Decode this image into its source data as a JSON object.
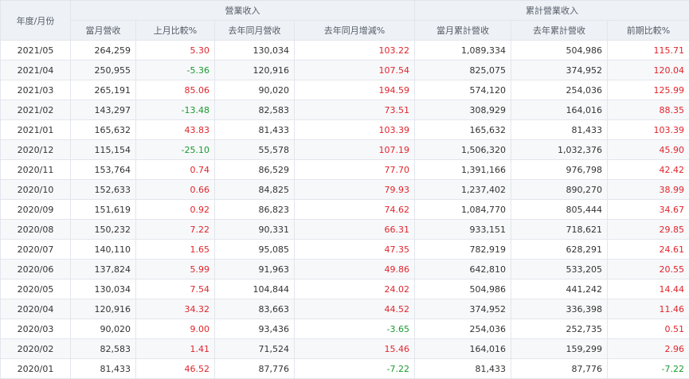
{
  "headers": {
    "month": "年度/月份",
    "group_revenue": "營業收入",
    "group_cumulative": "累計營業收入",
    "cols": [
      "當月營收",
      "上月比較%",
      "去年同月營收",
      "去年同月增減%",
      "當月累計營收",
      "去年累計營收",
      "前期比較%"
    ]
  },
  "colors": {
    "positive": "#e0242b",
    "negative": "#1a9a2f"
  },
  "rows": [
    [
      "2021/05",
      "264,259",
      "5.30",
      "130,034",
      "103.22",
      "1,089,334",
      "504,986",
      "115.71"
    ],
    [
      "2021/04",
      "250,955",
      "-5.36",
      "120,916",
      "107.54",
      "825,075",
      "374,952",
      "120.04"
    ],
    [
      "2021/03",
      "265,191",
      "85.06",
      "90,020",
      "194.59",
      "574,120",
      "254,036",
      "125.99"
    ],
    [
      "2021/02",
      "143,297",
      "-13.48",
      "82,583",
      "73.51",
      "308,929",
      "164,016",
      "88.35"
    ],
    [
      "2021/01",
      "165,632",
      "43.83",
      "81,433",
      "103.39",
      "165,632",
      "81,433",
      "103.39"
    ],
    [
      "2020/12",
      "115,154",
      "-25.10",
      "55,578",
      "107.19",
      "1,506,320",
      "1,032,376",
      "45.90"
    ],
    [
      "2020/11",
      "153,764",
      "0.74",
      "86,529",
      "77.70",
      "1,391,166",
      "976,798",
      "42.42"
    ],
    [
      "2020/10",
      "152,633",
      "0.66",
      "84,825",
      "79.93",
      "1,237,402",
      "890,270",
      "38.99"
    ],
    [
      "2020/09",
      "151,619",
      "0.92",
      "86,823",
      "74.62",
      "1,084,770",
      "805,444",
      "34.67"
    ],
    [
      "2020/08",
      "150,232",
      "7.22",
      "90,331",
      "66.31",
      "933,151",
      "718,621",
      "29.85"
    ],
    [
      "2020/07",
      "140,110",
      "1.65",
      "95,085",
      "47.35",
      "782,919",
      "628,291",
      "24.61"
    ],
    [
      "2020/06",
      "137,824",
      "5.99",
      "91,963",
      "49.86",
      "642,810",
      "533,205",
      "20.55"
    ],
    [
      "2020/05",
      "130,034",
      "7.54",
      "104,844",
      "24.02",
      "504,986",
      "441,242",
      "14.44"
    ],
    [
      "2020/04",
      "120,916",
      "34.32",
      "83,663",
      "44.52",
      "374,952",
      "336,398",
      "11.46"
    ],
    [
      "2020/03",
      "90,020",
      "9.00",
      "93,436",
      "-3.65",
      "254,036",
      "252,735",
      "0.51"
    ],
    [
      "2020/02",
      "82,583",
      "1.41",
      "71,524",
      "15.46",
      "164,016",
      "159,299",
      "2.96"
    ],
    [
      "2020/01",
      "81,433",
      "46.52",
      "87,776",
      "-7.22",
      "81,433",
      "87,776",
      "-7.22"
    ]
  ]
}
